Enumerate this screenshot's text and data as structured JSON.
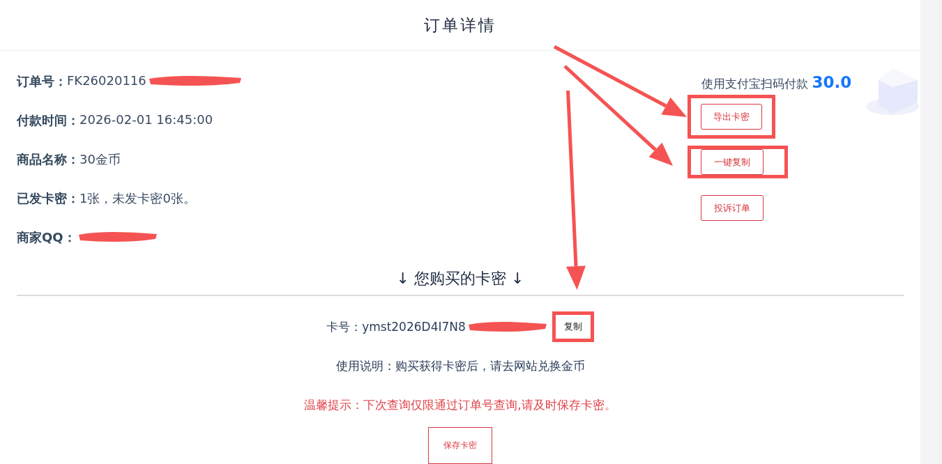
{
  "title": "订单详情",
  "info": [
    {
      "label": "订单号：",
      "value": "FK26020116",
      "redacted": true
    },
    {
      "label": "付款时间：",
      "value": "2026-02-01 16:45:00",
      "redacted": false
    },
    {
      "label": "商品名称：",
      "value": "30金币",
      "redacted": false
    },
    {
      "label": "已发卡密：",
      "value": "1张，未发卡密0张。",
      "redacted": false
    },
    {
      "label": "商家QQ：",
      "redacted": true
    }
  ],
  "payment": {
    "label": "使用支付宝扫码付款",
    "amount": "30.0"
  },
  "actions": [
    "导出卡密",
    "一键复制",
    "投诉订单"
  ],
  "cards_heading": "↓ 您购买的卡密 ↓",
  "card": {
    "label": "卡号：",
    "value": "ymst2026D4I7N8",
    "redacted": true,
    "copy_label": "复制"
  },
  "usage": "使用说明：购买获得卡密后，请去网站兑换金币",
  "warning": "温馨提示：下次查询仅限通过订单号查询,请及时保存卡密。",
  "save_button": "保存卡密"
}
